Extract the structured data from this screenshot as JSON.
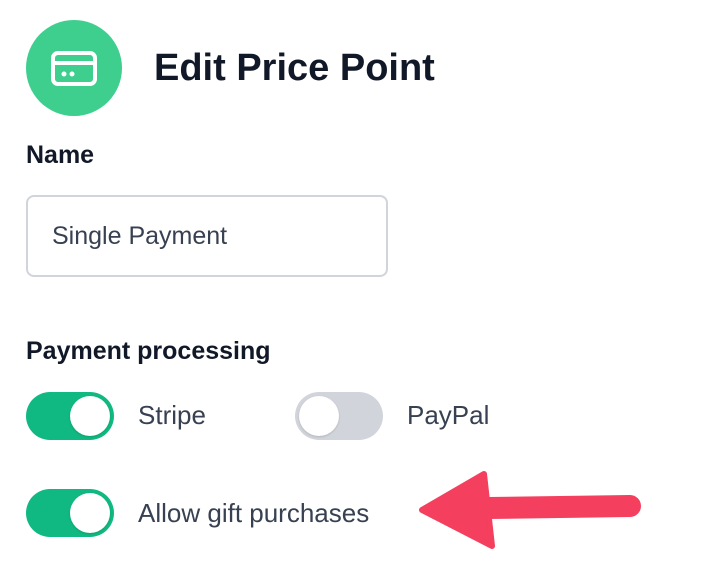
{
  "header": {
    "title": "Edit Price Point",
    "icon": "credit-card-icon",
    "icon_bg_color": "#3ecf8e"
  },
  "name_field": {
    "label": "Name",
    "value": "Single Payment"
  },
  "payment_processing": {
    "label": "Payment processing",
    "options": [
      {
        "label": "Stripe",
        "enabled": true
      },
      {
        "label": "PayPal",
        "enabled": false
      }
    ]
  },
  "gift": {
    "label": "Allow gift purchases",
    "enabled": true
  },
  "colors": {
    "toggle_on": "#10b981",
    "toggle_off": "#d1d5db",
    "annotation_arrow": "#f43f5e"
  }
}
